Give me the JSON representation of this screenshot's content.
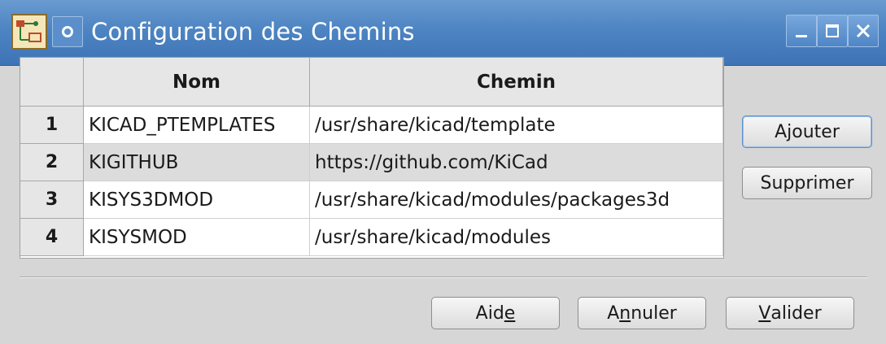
{
  "window": {
    "title": "Configuration des Chemins"
  },
  "table": {
    "headers": {
      "nom": "Nom",
      "chemin": "Chemin"
    },
    "rows": [
      {
        "num": "1",
        "nom": "KICAD_PTEMPLATES",
        "chemin": "/usr/share/kicad/template"
      },
      {
        "num": "2",
        "nom": "KIGITHUB",
        "chemin": "https://github.com/KiCad"
      },
      {
        "num": "3",
        "nom": "KISYS3DMOD",
        "chemin": "/usr/share/kicad/modules/packages3d"
      },
      {
        "num": "4",
        "nom": "KISYSMOD",
        "chemin": "/usr/share/kicad/modules"
      }
    ],
    "selected_row": 2
  },
  "buttons": {
    "add": "Ajouter",
    "remove": "Supprimer",
    "help_pre": "Aid",
    "help_mnemonic": "e",
    "cancel_pre": "A",
    "cancel_mnemonic": "n",
    "cancel_post": "nuler",
    "ok_mnemonic": "V",
    "ok_post": "alider"
  },
  "icons": {
    "app": "kicad-pcb-icon",
    "window_menu": "window-menu-icon",
    "minimize": "minimize-icon",
    "maximize": "maximize-icon",
    "close": "close-icon"
  },
  "colors": {
    "titlebar": "#4d84c2",
    "selected_row": "#dcdcdc",
    "default_button_border": "#5d8fc9"
  }
}
